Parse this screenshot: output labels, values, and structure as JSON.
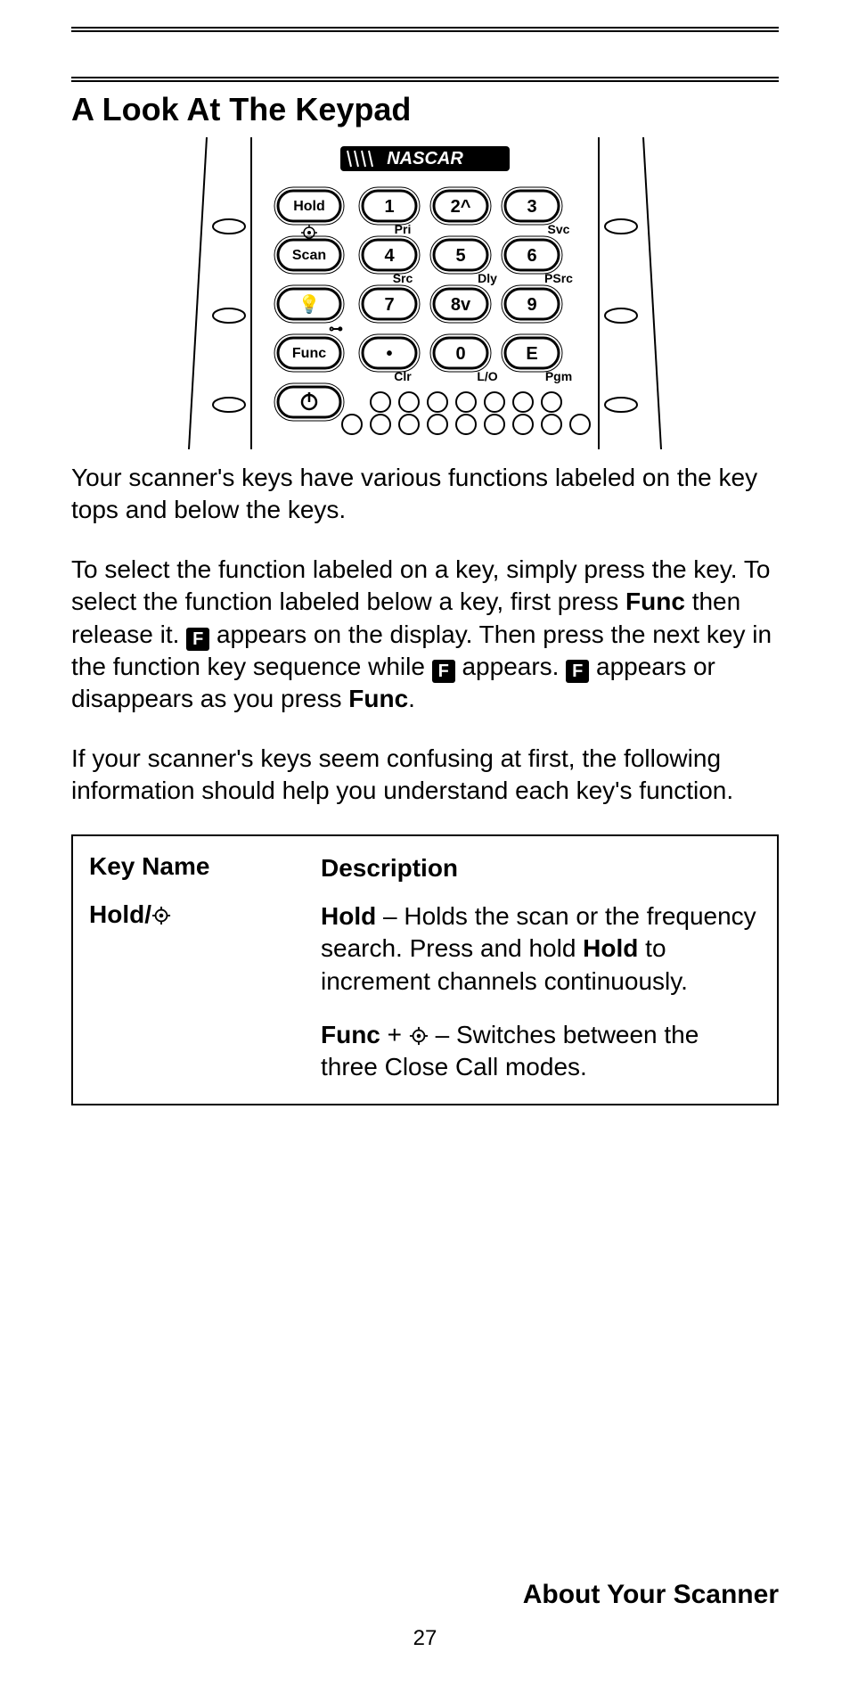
{
  "heading": "A Look At The Keypad",
  "keypad": {
    "brand": "NASCAR",
    "rows": [
      {
        "left_label": "Hold",
        "keys": [
          "1",
          "2^",
          "3"
        ],
        "subs": [
          "",
          "Pri",
          "",
          "Svc"
        ]
      },
      {
        "left_label": "Scan",
        "keys": [
          "4",
          "5",
          "6"
        ],
        "subs": [
          "",
          "Src",
          "Dly",
          "PSrc"
        ]
      },
      {
        "left_label": "light",
        "keys": [
          "7",
          "8v",
          "9"
        ],
        "subs": [
          "",
          "",
          "",
          ""
        ]
      },
      {
        "left_label": "Func",
        "keys": [
          "•",
          "0",
          "E"
        ],
        "subs": [
          "",
          "Clr",
          "L/O",
          "Pgm"
        ]
      }
    ],
    "power_row": {
      "left_label": "power"
    }
  },
  "para1": "Your scanner's keys have various functions labeled on the key tops and below the keys.",
  "para2": {
    "t1": "To select the function labeled on a key, simply press the key. To select the function labeled below a key, first press ",
    "b1": "Func",
    "t2": " then release it. ",
    "f1": "F",
    "t3": " appears on the display. Then press the next key in the function key sequence while ",
    "f2": "F",
    "t4": " appears. ",
    "f3": "F",
    "t5": " appears or disappears as you press ",
    "b2": "Func",
    "t6": "."
  },
  "para3": "If your scanner's keys seem confusing at first, the following information should help you understand each key's function.",
  "table": {
    "header": {
      "name": "Key Name",
      "desc": "Description"
    },
    "row1": {
      "name_prefix": "Hold/",
      "desc1": {
        "b1": "Hold",
        "t1": " – Holds the scan or the frequency search. Press and hold ",
        "b2": "Hold",
        "t2": " to increment channels continuously."
      },
      "desc2": {
        "b1": "Func",
        "t1": " + ",
        "t2": " – Switches between the three Close Call modes."
      }
    }
  },
  "footer": "About Your Scanner",
  "page_number": "27"
}
